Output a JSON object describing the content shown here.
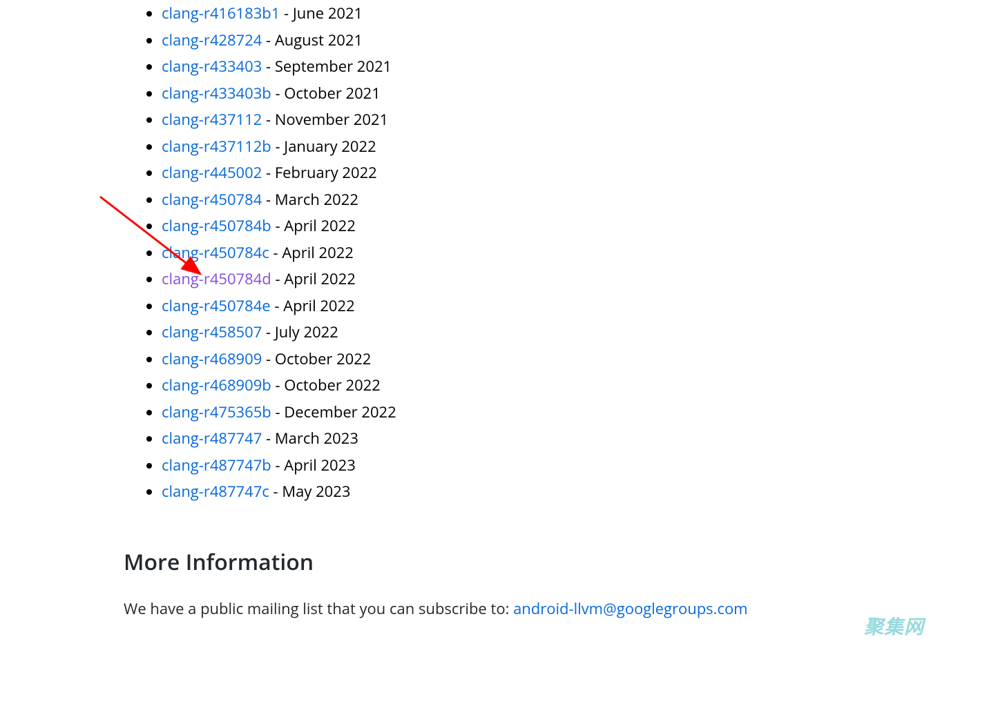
{
  "clang_items": [
    {
      "name": "clang-r416183b1",
      "date": "June 2021",
      "visited": false
    },
    {
      "name": "clang-r428724",
      "date": "August 2021",
      "visited": false
    },
    {
      "name": "clang-r433403",
      "date": "September 2021",
      "visited": false
    },
    {
      "name": "clang-r433403b",
      "date": "October 2021",
      "visited": false
    },
    {
      "name": "clang-r437112",
      "date": "November 2021",
      "visited": false
    },
    {
      "name": "clang-r437112b",
      "date": "January 2022",
      "visited": false
    },
    {
      "name": "clang-r445002",
      "date": "February 2022",
      "visited": false
    },
    {
      "name": "clang-r450784",
      "date": "March 2022",
      "visited": false
    },
    {
      "name": "clang-r450784b",
      "date": "April 2022",
      "visited": false
    },
    {
      "name": "clang-r450784c",
      "date": "April 2022",
      "visited": false
    },
    {
      "name": "clang-r450784d",
      "date": "April 2022",
      "visited": true
    },
    {
      "name": "clang-r450784e",
      "date": "April 2022",
      "visited": false
    },
    {
      "name": "clang-r458507",
      "date": "July 2022",
      "visited": false
    },
    {
      "name": "clang-r468909",
      "date": "October 2022",
      "visited": false
    },
    {
      "name": "clang-r468909b",
      "date": "October 2022",
      "visited": false
    },
    {
      "name": "clang-r475365b",
      "date": "December 2022",
      "visited": false
    },
    {
      "name": "clang-r487747",
      "date": "March 2023",
      "visited": false
    },
    {
      "name": "clang-r487747b",
      "date": "April 2023",
      "visited": false
    },
    {
      "name": "clang-r487747c",
      "date": "May 2023",
      "visited": false
    }
  ],
  "section_heading": "More Information",
  "info_paragraph_prefix": "We have a public mailing list that you can subscribe to: ",
  "info_email": "android-llvm@googlegroups.com",
  "watermark": "聚集网",
  "separator": " - "
}
